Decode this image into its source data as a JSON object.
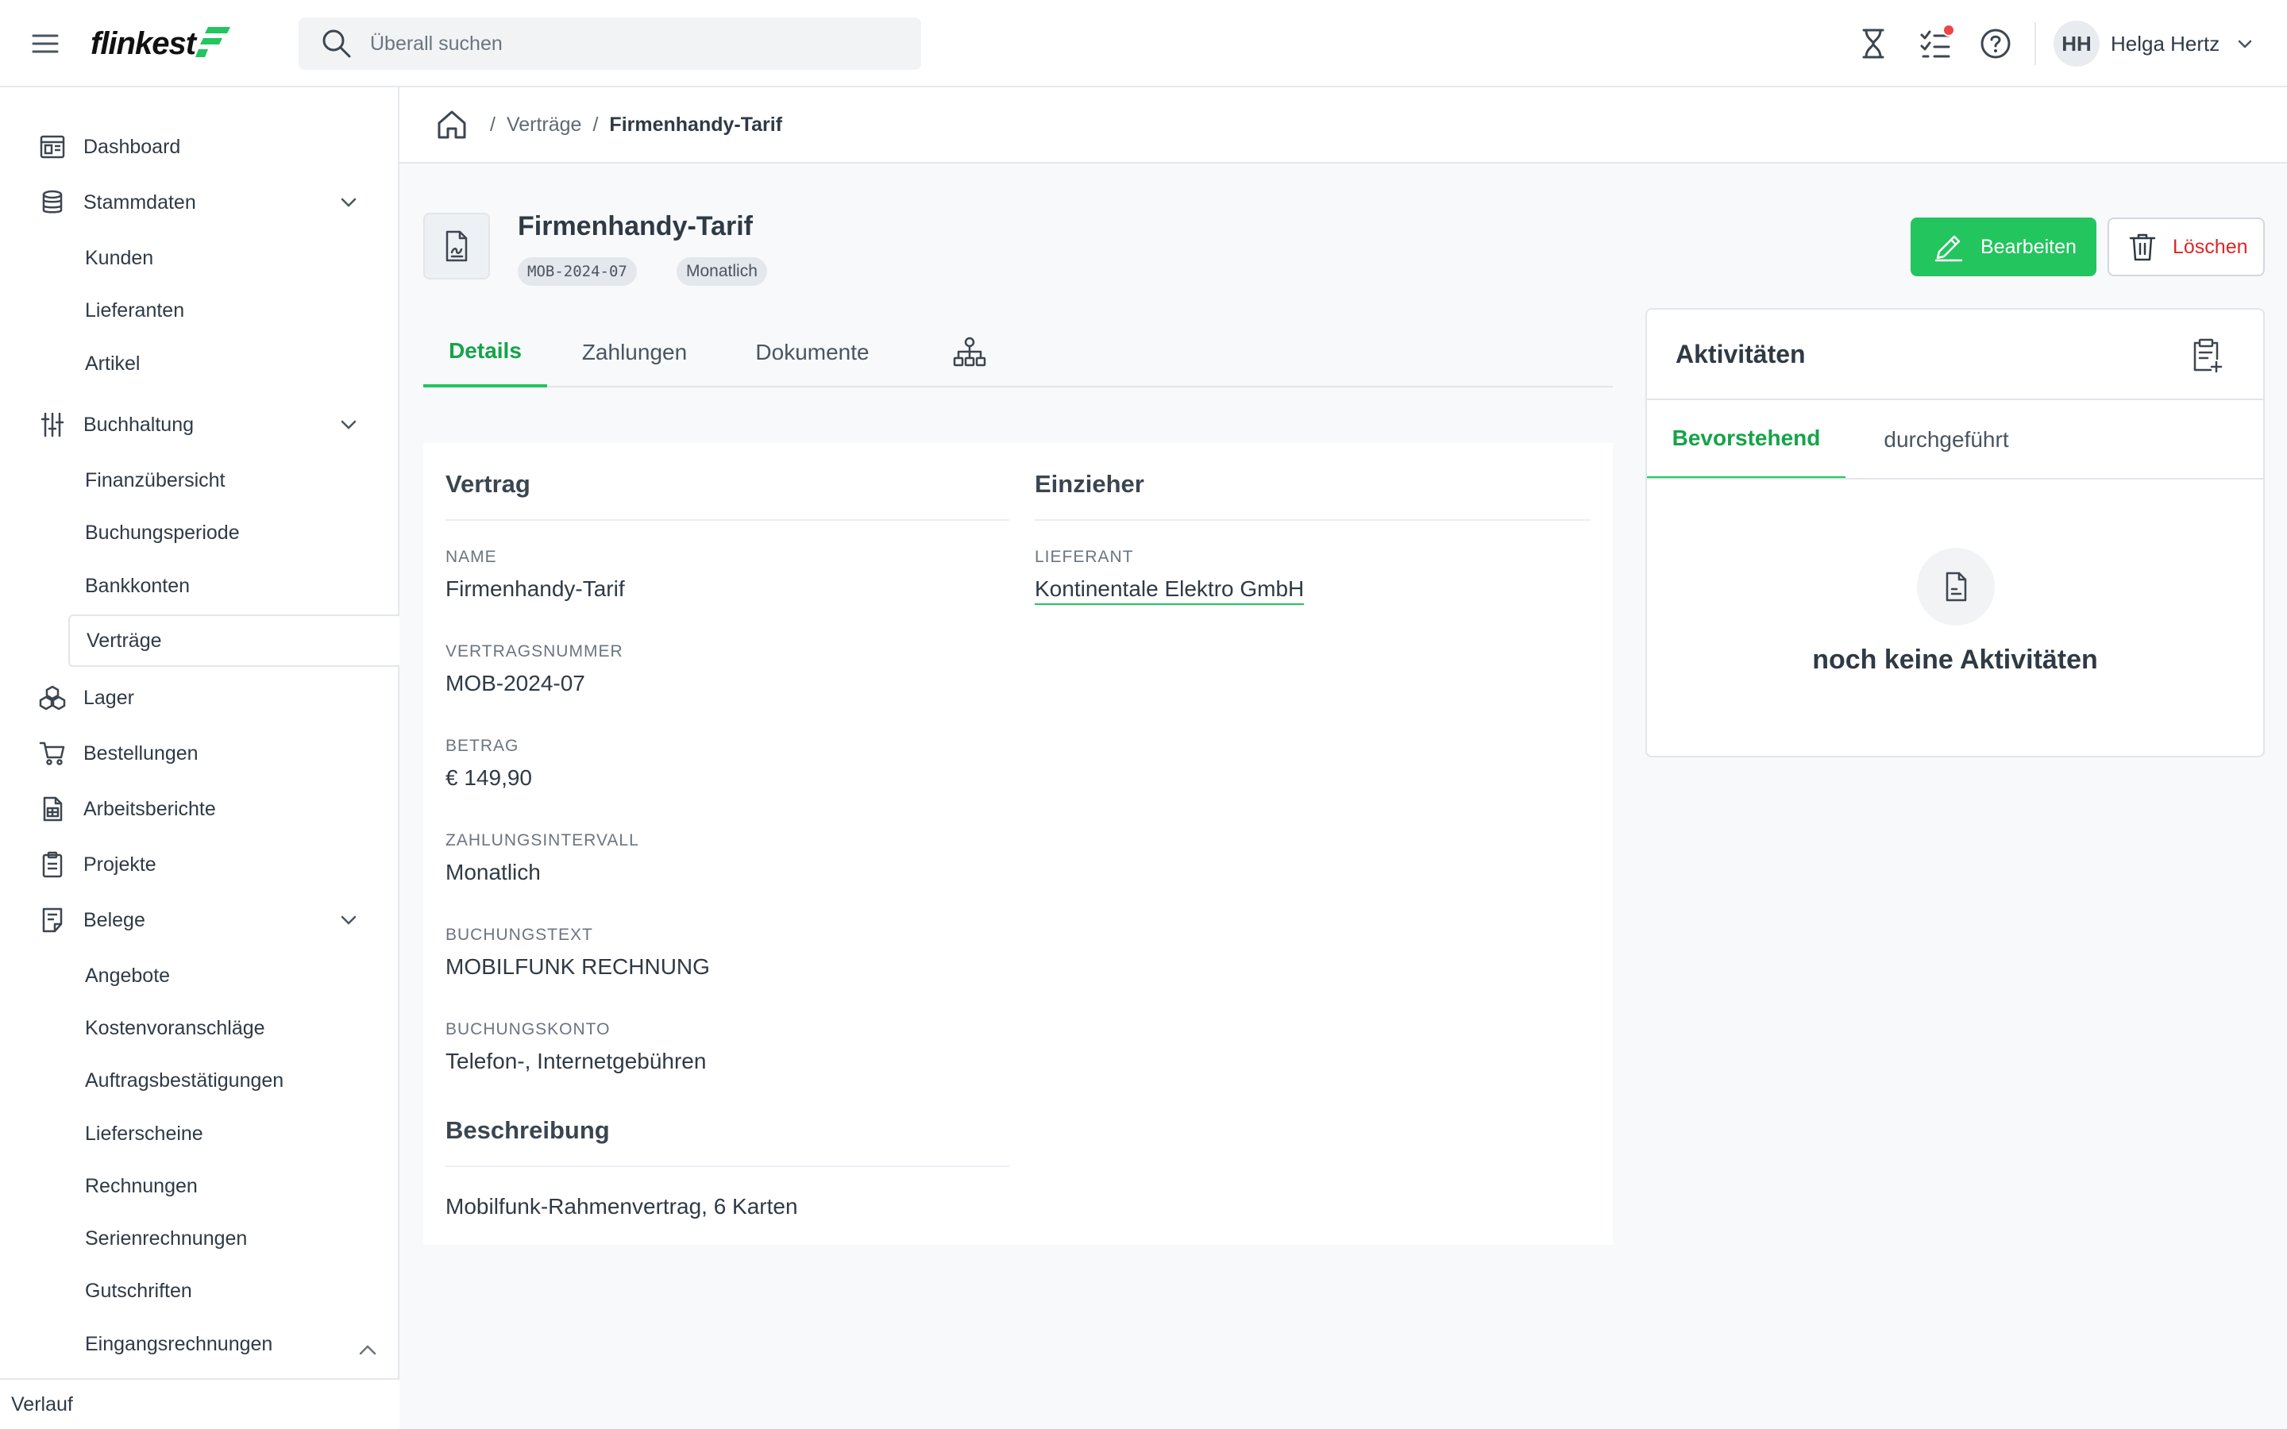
{
  "app": {
    "logo_text": "flinkest",
    "brand_color": "#22c55e"
  },
  "search": {
    "placeholder": "Überall suchen"
  },
  "user": {
    "initials": "HH",
    "name": "Helga Hertz"
  },
  "sidebar": {
    "items": [
      {
        "label": "Dashboard",
        "icon": "dashboard-icon"
      },
      {
        "label": "Stammdaten",
        "icon": "database-icon",
        "expanded": true,
        "children": [
          "Kunden",
          "Lieferanten",
          "Artikel"
        ]
      },
      {
        "label": "Buchhaltung",
        "icon": "sliders-icon",
        "expanded": true,
        "children": [
          "Finanzübersicht",
          "Buchungsperiode",
          "Bankkonten",
          "Verträge"
        ]
      },
      {
        "label": "Lager",
        "icon": "boxes-icon"
      },
      {
        "label": "Bestellungen",
        "icon": "cart-icon"
      },
      {
        "label": "Arbeitsberichte",
        "icon": "report-icon"
      },
      {
        "label": "Projekte",
        "icon": "clipboard-icon"
      },
      {
        "label": "Belege",
        "icon": "receipt-icon",
        "expanded": true,
        "children": [
          "Angebote",
          "Kostenvoranschläge",
          "Auftragsbestätigungen",
          "Lieferscheine",
          "Rechnungen",
          "Serienrechnungen",
          "Gutschriften",
          "Eingangsrechnungen"
        ]
      }
    ],
    "active_child": "Verträge",
    "footer_label": "Verlauf"
  },
  "breadcrumb": {
    "items": [
      "Verträge"
    ],
    "current": "Firmenhandy-Tarif"
  },
  "header": {
    "title": "Firmenhandy-Tarif",
    "tags": [
      "MOB-2024-07",
      "Monatlich"
    ],
    "edit_label": "Bearbeiten",
    "delete_label": "Löschen"
  },
  "tabs": {
    "items": [
      "Details",
      "Zahlungen",
      "Dokumente"
    ],
    "active": "Details",
    "extra_icon": "org-chart-icon"
  },
  "details": {
    "vertrag": {
      "heading": "Vertrag",
      "fields": [
        {
          "label": "Name",
          "value": "Firmenhandy-Tarif"
        },
        {
          "label": "Vertragsnummer",
          "value": "MOB-2024-07"
        },
        {
          "label": "Betrag",
          "value": "€ 149,90"
        },
        {
          "label": "Zahlungsintervall",
          "value": "Monatlich"
        },
        {
          "label": "Buchungstext",
          "value": "MOBILFUNK RECHNUNG"
        },
        {
          "label": "Buchungskonto",
          "value": "Telefon-, Internetgebühren"
        }
      ]
    },
    "einzieher": {
      "heading": "Einzieher",
      "label": "Lieferant",
      "value": "Kontinentale Elektro GmbH"
    },
    "beschreibung": {
      "heading": "Beschreibung",
      "value": "Mobilfunk-Rahmenvertrag, 6 Karten"
    }
  },
  "activities": {
    "title": "Aktivitäten",
    "tabs": [
      "Bevorstehend",
      "durchgeführt"
    ],
    "active_tab": "Bevorstehend",
    "empty_text": "noch keine Aktivitäten"
  }
}
